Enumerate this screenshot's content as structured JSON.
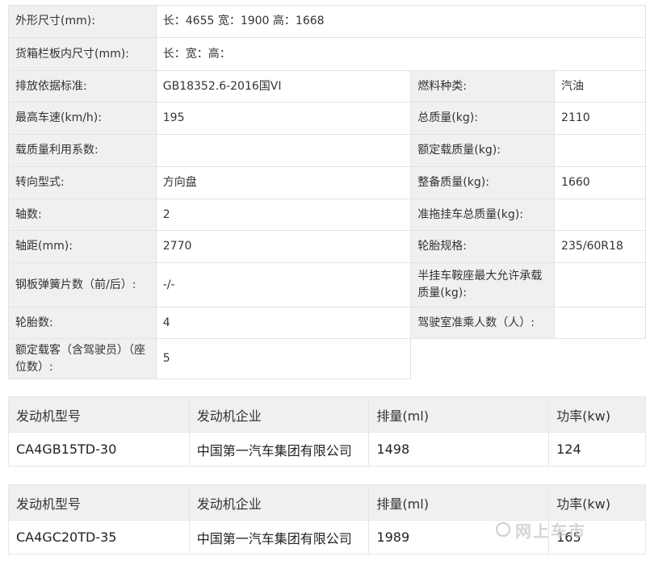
{
  "spec": {
    "outer_size": {
      "label": "外形尺寸(mm):",
      "value": "长：4655 宽：1900 高：1668"
    },
    "cargo_size": {
      "label": "货箱栏板内尺寸(mm):",
      "value": "长：宽：高："
    },
    "emission": {
      "label": "排放依据标准:",
      "value": "GB18352.6-2016国VI"
    },
    "fuel": {
      "label": "燃料种类:",
      "value": "汽油"
    },
    "max_speed": {
      "label": "最高车速(km/h):",
      "value": "195"
    },
    "total_mass": {
      "label": "总质量(kg):",
      "value": "2110"
    },
    "load_coef": {
      "label": "载质量利用系数:",
      "value": ""
    },
    "rated_load": {
      "label": "额定载质量(kg):",
      "value": ""
    },
    "steering": {
      "label": "转向型式:",
      "value": "方向盘"
    },
    "curb_mass": {
      "label": "整备质量(kg):",
      "value": "1660"
    },
    "axles": {
      "label": "轴数:",
      "value": "2"
    },
    "trailer_mass": {
      "label": "准拖挂车总质量(kg):",
      "value": ""
    },
    "wheelbase": {
      "label": "轴距(mm):",
      "value": "2770"
    },
    "tire_spec": {
      "label": "轮胎规格:",
      "value": "235/60R18"
    },
    "leaf_springs": {
      "label": "钢板弹簧片数（前/后）:",
      "value": "-/-"
    },
    "saddle_load": {
      "label": "半挂车鞍座最大允许承载质量(kg):",
      "value": ""
    },
    "tires": {
      "label": "轮胎数:",
      "value": "4"
    },
    "cab_seats": {
      "label": "驾驶室准乘人数（人）:",
      "value": ""
    },
    "rated_seats": {
      "label": "额定载客（含驾驶员）（座位数）:",
      "value": "5"
    }
  },
  "engines": [
    {
      "headers": [
        "发动机型号",
        "发动机企业",
        "排量(ml)",
        "功率(kw)"
      ],
      "row": [
        "CA4GB15TD-30",
        "中国第一汽车集团有限公司",
        "1498",
        "124"
      ]
    },
    {
      "headers": [
        "发动机型号",
        "发动机企业",
        "排量(ml)",
        "功率(kw)"
      ],
      "row": [
        "CA4GC20TD-35",
        "中国第一汽车集团有限公司",
        "1989",
        "165"
      ]
    }
  ],
  "watermark": {
    "text": "网上车市"
  }
}
